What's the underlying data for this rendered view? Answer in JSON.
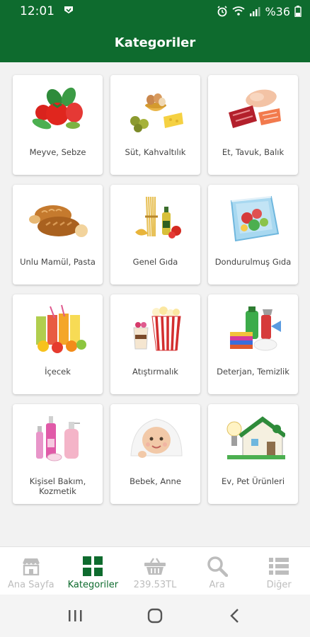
{
  "status_bar": {
    "time": "12:01",
    "battery": "%36"
  },
  "app_bar": {
    "title": "Kategoriler"
  },
  "categories": [
    {
      "label": "Meyve, Sebze",
      "icon": "vegetables-icon"
    },
    {
      "label": "Süt, Kahvaltılık",
      "icon": "dairy-breakfast-icon"
    },
    {
      "label": "Et, Tavuk, Balık",
      "icon": "meat-fish-icon"
    },
    {
      "label": "Unlu Mamül, Pasta",
      "icon": "bread-icon"
    },
    {
      "label": "Genel Gıda",
      "icon": "pasta-oil-icon"
    },
    {
      "label": "Dondurulmuş Gıda",
      "icon": "frozen-food-icon"
    },
    {
      "label": "İçecek",
      "icon": "juice-icon"
    },
    {
      "label": "Atıştırmalık",
      "icon": "popcorn-icon"
    },
    {
      "label": "Deterjan, Temizlik",
      "icon": "cleaning-icon"
    },
    {
      "label": "Kişisel Bakım, Kozmetik",
      "icon": "cosmetics-icon"
    },
    {
      "label": "Bebek, Anne",
      "icon": "baby-icon"
    },
    {
      "label": "Ev, Pet Ürünleri",
      "icon": "home-pet-icon"
    }
  ],
  "bottom_nav": [
    {
      "label": "Ana Sayfa",
      "icon": "store-icon",
      "active": false
    },
    {
      "label": "Kategoriler",
      "icon": "grid-icon",
      "active": true
    },
    {
      "label": "239.53TL",
      "icon": "basket-icon",
      "active": false
    },
    {
      "label": "Ara",
      "icon": "search-icon",
      "active": false
    },
    {
      "label": "Diğer",
      "icon": "list-icon",
      "active": false
    }
  ],
  "colors": {
    "primary": "#0e6b2e",
    "inactive": "#bdbdbd",
    "background": "#f2f2f2"
  }
}
